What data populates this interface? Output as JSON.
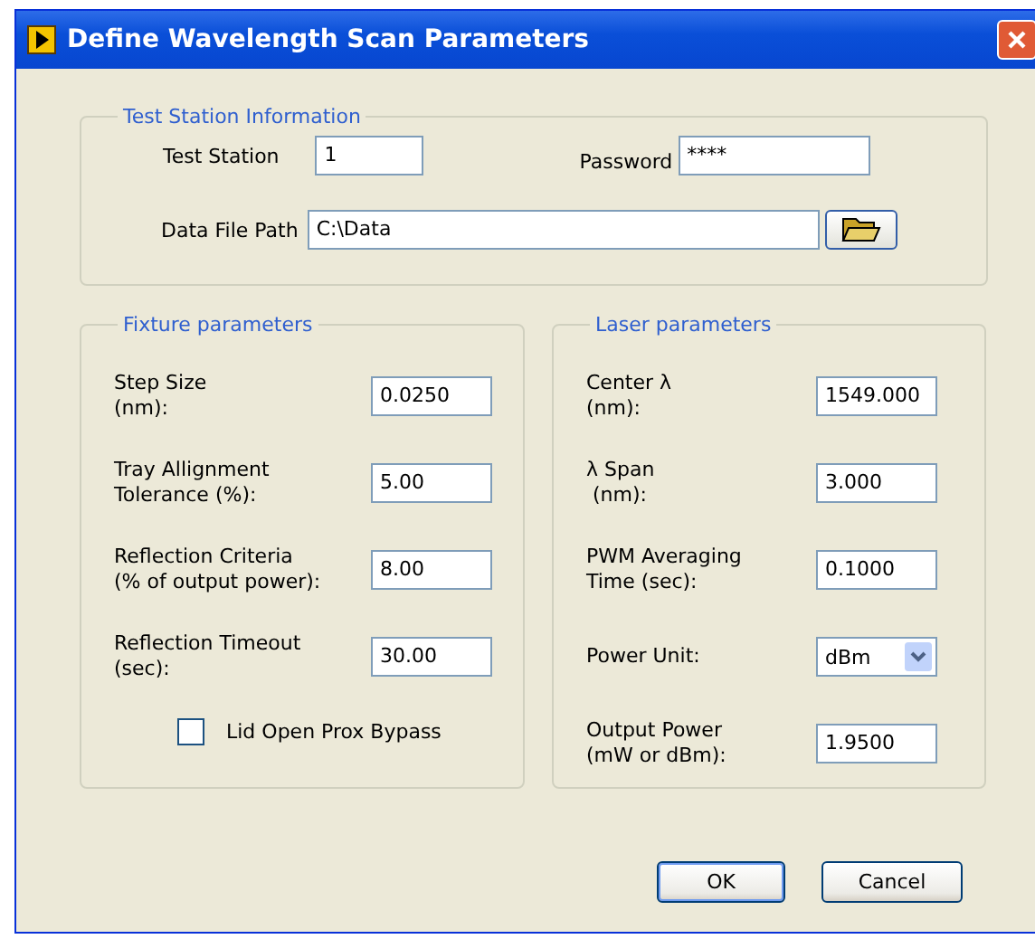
{
  "window": {
    "title": "Define Wavelength Scan Parameters"
  },
  "station_group": {
    "legend": "Test Station Information",
    "test_station": {
      "label": "Test Station",
      "value": "1"
    },
    "password": {
      "label": "Password",
      "value": "****"
    },
    "data_file_path": {
      "label": "Data File Path",
      "value": "C:\\Data"
    }
  },
  "fixture_group": {
    "legend": "Fixture parameters",
    "rows": [
      {
        "kind": "field",
        "label_lines": [
          "Step Size",
          "(nm):"
        ],
        "value": "0.0250"
      },
      {
        "kind": "field",
        "label_lines": [
          "Tray Allignment",
          "Tolerance (%):"
        ],
        "value": "5.00"
      },
      {
        "kind": "field",
        "label_lines": [
          "Reflection Criteria",
          "(% of output power):"
        ],
        "value": "8.00"
      },
      {
        "kind": "field",
        "label_lines": [
          "Reflection Timeout",
          "(sec):"
        ],
        "value": "30.00"
      },
      {
        "kind": "checkbox",
        "label_lines": [
          "Lid Open Prox Bypass"
        ],
        "checked": false
      }
    ]
  },
  "laser_group": {
    "legend": "Laser parameters",
    "rows": [
      {
        "kind": "field",
        "label_lines": [
          "Center λ",
          "(nm):"
        ],
        "value": "1549.000"
      },
      {
        "kind": "field",
        "label_lines": [
          "λ Span",
          " (nm):"
        ],
        "value": "3.000"
      },
      {
        "kind": "field",
        "label_lines": [
          "PWM Averaging",
          "Time (sec):"
        ],
        "value": "0.1000"
      },
      {
        "kind": "dropdown",
        "label_lines": [
          "Power Unit:"
        ],
        "value": "dBm"
      },
      {
        "kind": "field",
        "label_lines": [
          "Output Power",
          "(mW or dBm):"
        ],
        "value": "1.9500"
      }
    ]
  },
  "buttons": [
    "OK",
    "Cancel"
  ]
}
